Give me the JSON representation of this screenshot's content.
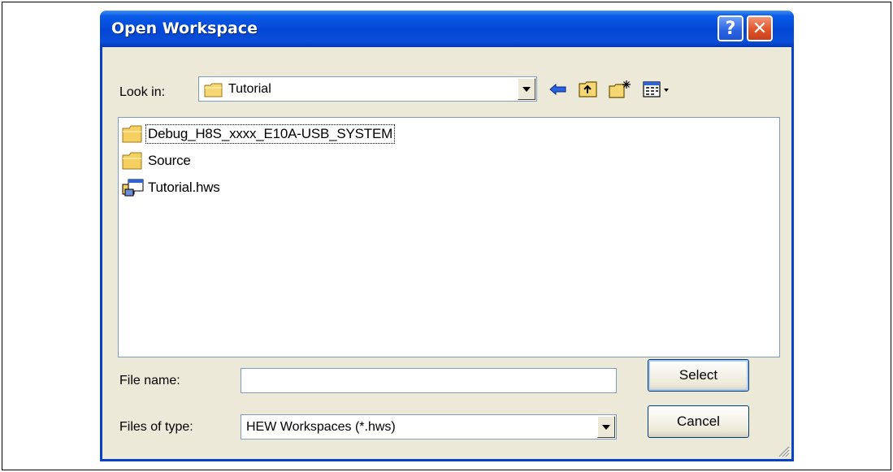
{
  "dialog": {
    "title": "Open Workspace",
    "help_label": "?",
    "close_label": "✕"
  },
  "look_in": {
    "label": "Look in:",
    "value": "Tutorial"
  },
  "toolbar": {
    "icons": [
      "back-arrow-icon",
      "up-folder-icon",
      "new-folder-icon",
      "view-menu-icon"
    ]
  },
  "files": [
    {
      "name": "Debug_H8S_xxxx_E10A-USB_SYSTEM",
      "icon": "folder-icon",
      "focused": true
    },
    {
      "name": "Source",
      "icon": "folder-icon",
      "focused": false
    },
    {
      "name": "Tutorial.hws",
      "icon": "workspace-file-icon",
      "focused": false
    }
  ],
  "file_name": {
    "label": "File name:",
    "value": ""
  },
  "files_of_type": {
    "label": "Files of type:",
    "value": "HEW Workspaces (*.hws)"
  },
  "buttons": {
    "select": "Select",
    "cancel": "Cancel"
  },
  "colors": {
    "titlebar": "#0a5ae8",
    "close": "#e2542a",
    "dialog_bg": "#ece9d8"
  }
}
